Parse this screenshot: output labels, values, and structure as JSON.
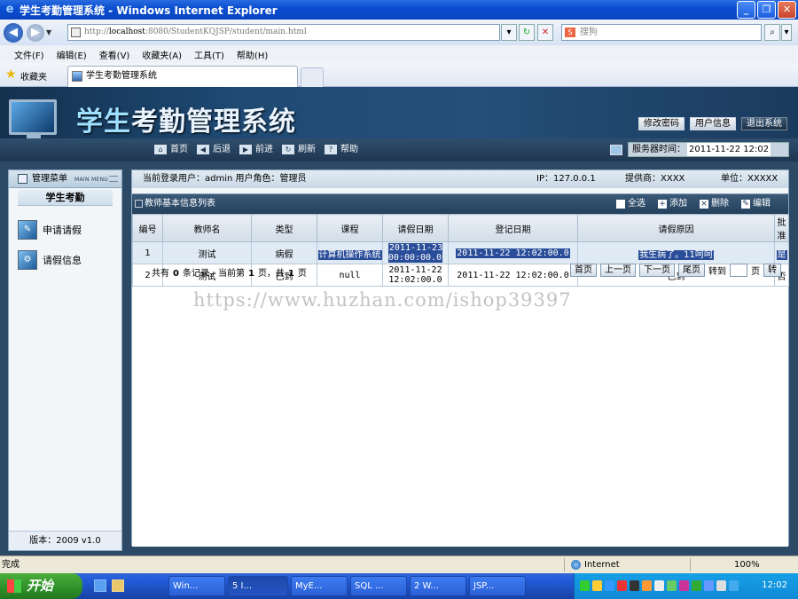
{
  "window": {
    "title": "学生考勤管理系统 - Windows Internet Explorer",
    "minimize": "_",
    "maximize": "❐",
    "close": "✕"
  },
  "browser": {
    "url_prefix": "http://",
    "url_host": "localhost",
    "url_path": ":8080/StudentKQJSP/student/main.html",
    "search_placeholder": "搜狗",
    "menu": [
      "文件(F)",
      "编辑(E)",
      "查看(V)",
      "收藏夹(A)",
      "工具(T)",
      "帮助(H)"
    ],
    "favorites_label": "收藏夹",
    "tab_title": "学生考勤管理系统"
  },
  "app": {
    "title_part1": "学生",
    "title_part2": "考勤管理系统",
    "header_buttons": [
      "修改密码",
      "用户信息",
      "退出系统"
    ],
    "nav": [
      "首页",
      "后退",
      "前进",
      "刷新",
      "帮助"
    ],
    "server_time_label": "服务器时间：",
    "server_time_value": "2011-11-22 12:02"
  },
  "sidebar": {
    "title": "管理菜单",
    "title_en": "MAIN MENU",
    "group": "学生考勤",
    "items": [
      "申请请假",
      "请假信息"
    ],
    "footer": "版本：2009 v1.0"
  },
  "infobar": {
    "user": "当前登录用户：admin  用户角色：管理员",
    "ip": "IP：127.0.0.1",
    "provider": "提供商：XXXX",
    "unit": "单位：XXXXX"
  },
  "panel": {
    "title": "教师基本信息列表",
    "actions": [
      "全选",
      "添加",
      "删除",
      "编辑"
    ]
  },
  "table": {
    "headers": [
      "编号",
      "教师名",
      "类型",
      "课程",
      "请假日期",
      "登记日期",
      "请假原因",
      "批准"
    ],
    "rows": [
      [
        "1",
        "测试",
        "病假",
        "计算机操作系统",
        "2011-11-23 00:00:00.0",
        "2011-11-22 12:02:00.0",
        "我生病了。11呵呵",
        "是"
      ],
      [
        "2",
        "测试",
        "已到",
        "null",
        "2011-11-22 12:02:00.0",
        "2011-11-22 12:02:00.0",
        "已到",
        "否"
      ]
    ]
  },
  "pager": {
    "prefix": "共有",
    "total": "0",
    "mid1": "条记录，当前第",
    "current": "1",
    "mid2": "页，共",
    "pages": "1",
    "suffix": "页",
    "buttons": [
      "首页",
      "上一页",
      "下一页",
      "尾页"
    ],
    "goto_label": "转到",
    "page_label": "页",
    "go": "转"
  },
  "watermark": "https://www.huzhan.com/ishop39397",
  "status": {
    "text": "完成",
    "zone": "Internet",
    "zoom": "100%"
  },
  "taskbar": {
    "start": "开始",
    "tasks": [
      "Win...",
      "5 I...",
      "MyE...",
      "SQL ...",
      "2 W...",
      "JSP..."
    ],
    "clock": "12:02"
  },
  "colors": {
    "title_bar": "#0a4fd0",
    "app_header": "#1e4a74",
    "selection": "#2a4d99",
    "start_button": "#2d8f28"
  }
}
